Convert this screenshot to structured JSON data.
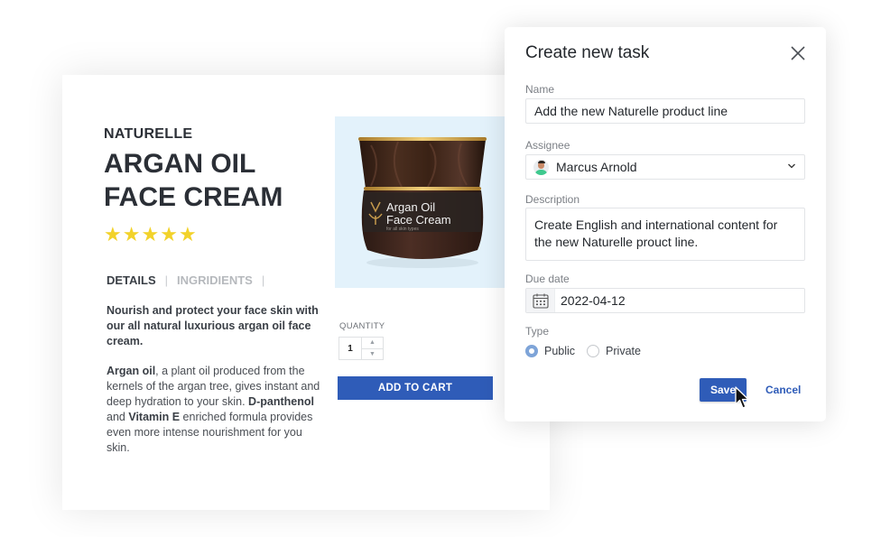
{
  "product": {
    "brand": "NATURELLE",
    "title": "ARGAN OIL FACE CREAM",
    "rating": 5,
    "rating_max": 5,
    "star_glyph": "★",
    "tabs": [
      {
        "label": "DETAILS",
        "active": true
      },
      {
        "label": "INGRIDIENTS",
        "active": false
      }
    ],
    "tab_separator": "|",
    "intro": "Nourish and protect your face skin with our all natural luxurious argan oil face cream.",
    "description": {
      "bold_1": "Argan oil",
      "text_1": ", a plant oil produced from the kernels of the argan tree, gives instant and deep hydration to your skin. ",
      "bold_2": "D-panthenol",
      "text_2": " and ",
      "bold_3": "Vitamin E",
      "text_3": " enriched formula provides even more intense nourishment for you skin."
    },
    "image": {
      "label_line1": "Argan Oil",
      "label_line2": "Face Cream",
      "label_sub": "for all skin types"
    },
    "quantity_label": "QUANTITY",
    "quantity": "1",
    "up_arrow": "▲",
    "down_arrow": "▼",
    "add_to_cart": "ADD TO CART"
  },
  "dialog": {
    "title": "Create new task",
    "name_label": "Name",
    "name_value": "Add the new Naturelle product line",
    "assignee_label": "Assignee",
    "assignee_value": "Marcus Arnold",
    "chevron": "⌄",
    "description_label": "Description",
    "description_value": "Create English and international content for the new Naturelle prouct line.",
    "due_label": "Due date",
    "due_value": "2022-04-12",
    "type_label": "Type",
    "type_options": [
      {
        "label": "Public",
        "selected": true
      },
      {
        "label": "Private",
        "selected": false
      }
    ],
    "save_label": "Save",
    "cancel_label": "Cancel"
  },
  "colors": {
    "accent": "#2f5cb8",
    "star": "#f2d22a",
    "radio_selected": "#7ea4d8",
    "image_bg": "#e3f2fb"
  }
}
